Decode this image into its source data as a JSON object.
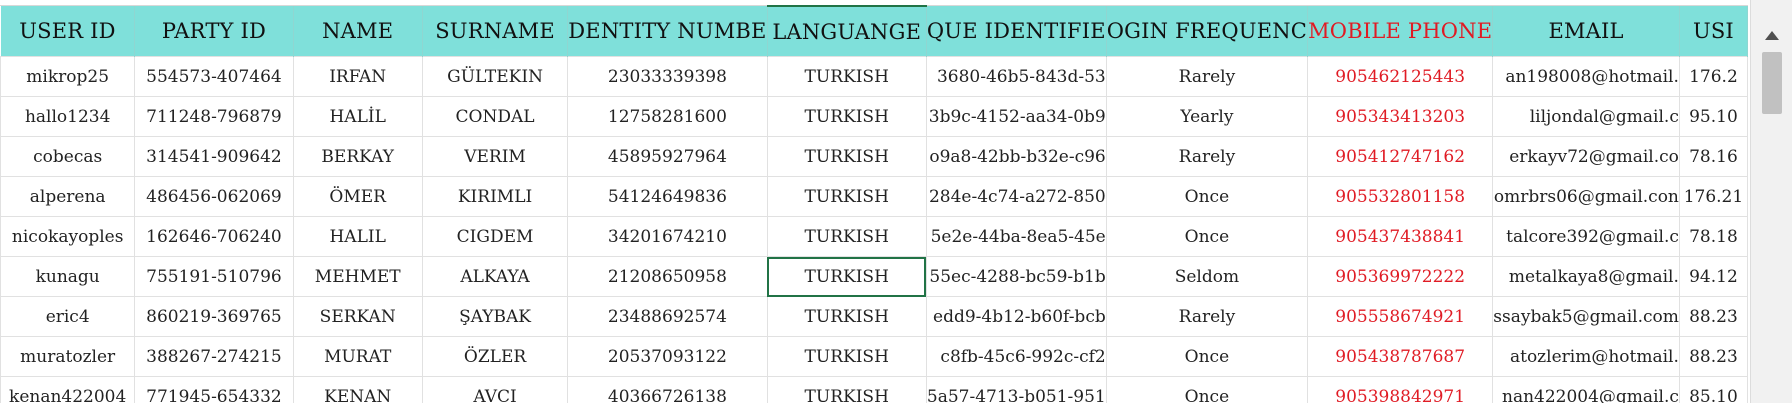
{
  "columns": [
    {
      "key": "user_id",
      "label": "USER ID"
    },
    {
      "key": "party_id",
      "label": "PARTY ID"
    },
    {
      "key": "name",
      "label": "NAME"
    },
    {
      "key": "surname",
      "label": "SURNAME"
    },
    {
      "key": "identity_number",
      "label": "DENTITY NUMBE"
    },
    {
      "key": "language",
      "label": "LANGUANGE"
    },
    {
      "key": "unique_identifier",
      "label": "QUE IDENTIFIE"
    },
    {
      "key": "login_frequency",
      "label": "OGIN FREQUENC"
    },
    {
      "key": "mobile_phone",
      "label": "MOBILE PHONE"
    },
    {
      "key": "email",
      "label": "EMAIL"
    },
    {
      "key": "usr",
      "label": "USI"
    }
  ],
  "rows": [
    {
      "user_id": "mikrop25",
      "party_id": "554573-407464",
      "name": "IRFAN",
      "surname": "GÜLTEKIN",
      "identity_number": "23033339398",
      "language": "TURKISH",
      "unique_identifier": "3680-46b5-843d-53",
      "login_frequency": "Rarely",
      "mobile_phone": "905462125443",
      "email": "an198008@hotmail.",
      "usr": "176.2"
    },
    {
      "user_id": "hallo1234",
      "party_id": "711248-796879",
      "name": "HALİL",
      "surname": "CONDAL",
      "identity_number": "12758281600",
      "language": "TURKISH",
      "unique_identifier": "3b9c-4152-aa34-0b9",
      "login_frequency": "Yearly",
      "mobile_phone": "905343413203",
      "email": "liljondal@gmail.c",
      "usr": "95.10"
    },
    {
      "user_id": "cobecas",
      "party_id": "314541-909642",
      "name": "BERKAY",
      "surname": "VERIM",
      "identity_number": "45895927964",
      "language": "TURKISH",
      "unique_identifier": "o9a8-42bb-b32e-c96",
      "login_frequency": "Rarely",
      "mobile_phone": "905412747162",
      "email": "erkayv72@gmail.co",
      "usr": "78.16"
    },
    {
      "user_id": "alperena",
      "party_id": "486456-062069",
      "name": "ÖMER",
      "surname": "KIRIMLI",
      "identity_number": "54124649836",
      "language": "TURKISH",
      "unique_identifier": "284e-4c74-a272-850",
      "login_frequency": "Once",
      "mobile_phone": "905532801158",
      "email": "omrbrs06@gmail.con",
      "usr": "176.21"
    },
    {
      "user_id": "nicokayoples",
      "party_id": "162646-706240",
      "name": "HALIL",
      "surname": "CIGDEM",
      "identity_number": "34201674210",
      "language": "TURKISH",
      "unique_identifier": "5e2e-44ba-8ea5-45e",
      "login_frequency": "Once",
      "mobile_phone": "905437438841",
      "email": "talcore392@gmail.c",
      "usr": "78.18"
    },
    {
      "user_id": "kunagu",
      "party_id": "755191-510796",
      "name": "MEHMET",
      "surname": "ALKAYA",
      "identity_number": "21208650958",
      "language": "TURKISH",
      "unique_identifier": "55ec-4288-bc59-b1b",
      "login_frequency": "Seldom",
      "mobile_phone": "905369972222",
      "email": "metalkaya8@gmail.",
      "usr": "94.12"
    },
    {
      "user_id": "eric4",
      "party_id": "860219-369765",
      "name": "SERKAN",
      "surname": "ŞAYBAK",
      "identity_number": "23488692574",
      "language": "TURKISH",
      "unique_identifier": "edd9-4b12-b60f-bcb",
      "login_frequency": "Rarely",
      "mobile_phone": "905558674921",
      "email": "ssaybak5@gmail.com",
      "usr": "88.23"
    },
    {
      "user_id": "muratozler",
      "party_id": "388267-274215",
      "name": "MURAT",
      "surname": "ÖZLER",
      "identity_number": "20537093122",
      "language": "TURKISH",
      "unique_identifier": "c8fb-45c6-992c-cf2",
      "login_frequency": "Once",
      "mobile_phone": "905438787687",
      "email": "atozlerim@hotmail.",
      "usr": "88.23"
    },
    {
      "user_id": "kenan422004",
      "party_id": "771945-654332",
      "name": "KENAN",
      "surname": "AVCI",
      "identity_number": "40366726138",
      "language": "TURKISH",
      "unique_identifier": "5a57-4713-b051-951",
      "login_frequency": "Once",
      "mobile_phone": "905398842971",
      "email": "nan422004@gmail.c",
      "usr": "85.10"
    }
  ],
  "header_color": "#7fe0da",
  "highlight_column": "mobile_phone",
  "highlight_color": "#e01b24",
  "selection": {
    "row": 5,
    "column": "language",
    "color": "#217346"
  },
  "scrollbar": {
    "up_icon": "arrow-up-icon"
  }
}
